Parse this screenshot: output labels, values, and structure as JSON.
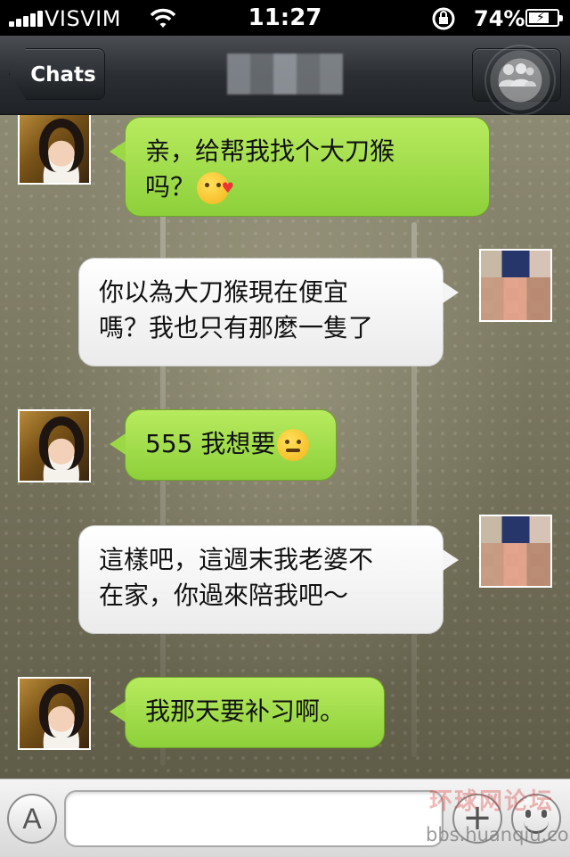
{
  "status_bar": {
    "carrier": "VISVIM",
    "time": "11:27",
    "battery_percent": "74%",
    "battery_level": 0.74,
    "icons": [
      "signal-icon",
      "wifi-icon",
      "rotation-lock-icon",
      "battery-charging-icon"
    ]
  },
  "nav": {
    "back_label": "Chats",
    "group_icon": "group-chat-icon"
  },
  "messages": [
    {
      "side": "received",
      "text_line1": "亲，给帮我找个大刀猴",
      "text_line2": "吗？",
      "emoji": "kissing-face-emoji"
    },
    {
      "side": "sent",
      "text_line1": "你以為大刀猴現在便宜",
      "text_line2": "嗎？我也只有那麼一隻了"
    },
    {
      "side": "received",
      "text_line1": "555 我想要",
      "emoji": "confounded-face-emoji"
    },
    {
      "side": "sent",
      "text_line1": "這樣吧，這週末我老婆不",
      "text_line2": "在家，你過來陪我吧～"
    },
    {
      "side": "received",
      "text_line1": "我那天要补习啊。"
    }
  ],
  "input_bar": {
    "voice_label": "A",
    "message_value": "",
    "plus_label": "+",
    "icons": [
      "voice-toggle-icon",
      "plus-icon",
      "emoji-icon"
    ]
  },
  "watermark": {
    "logo_text": "环球网论坛",
    "url": "bbs.huanqiu.com"
  },
  "colors": {
    "received_bubble": "#9ad846",
    "sent_bubble": "#f4f4f4",
    "nav_bar": "#2b2f33"
  }
}
